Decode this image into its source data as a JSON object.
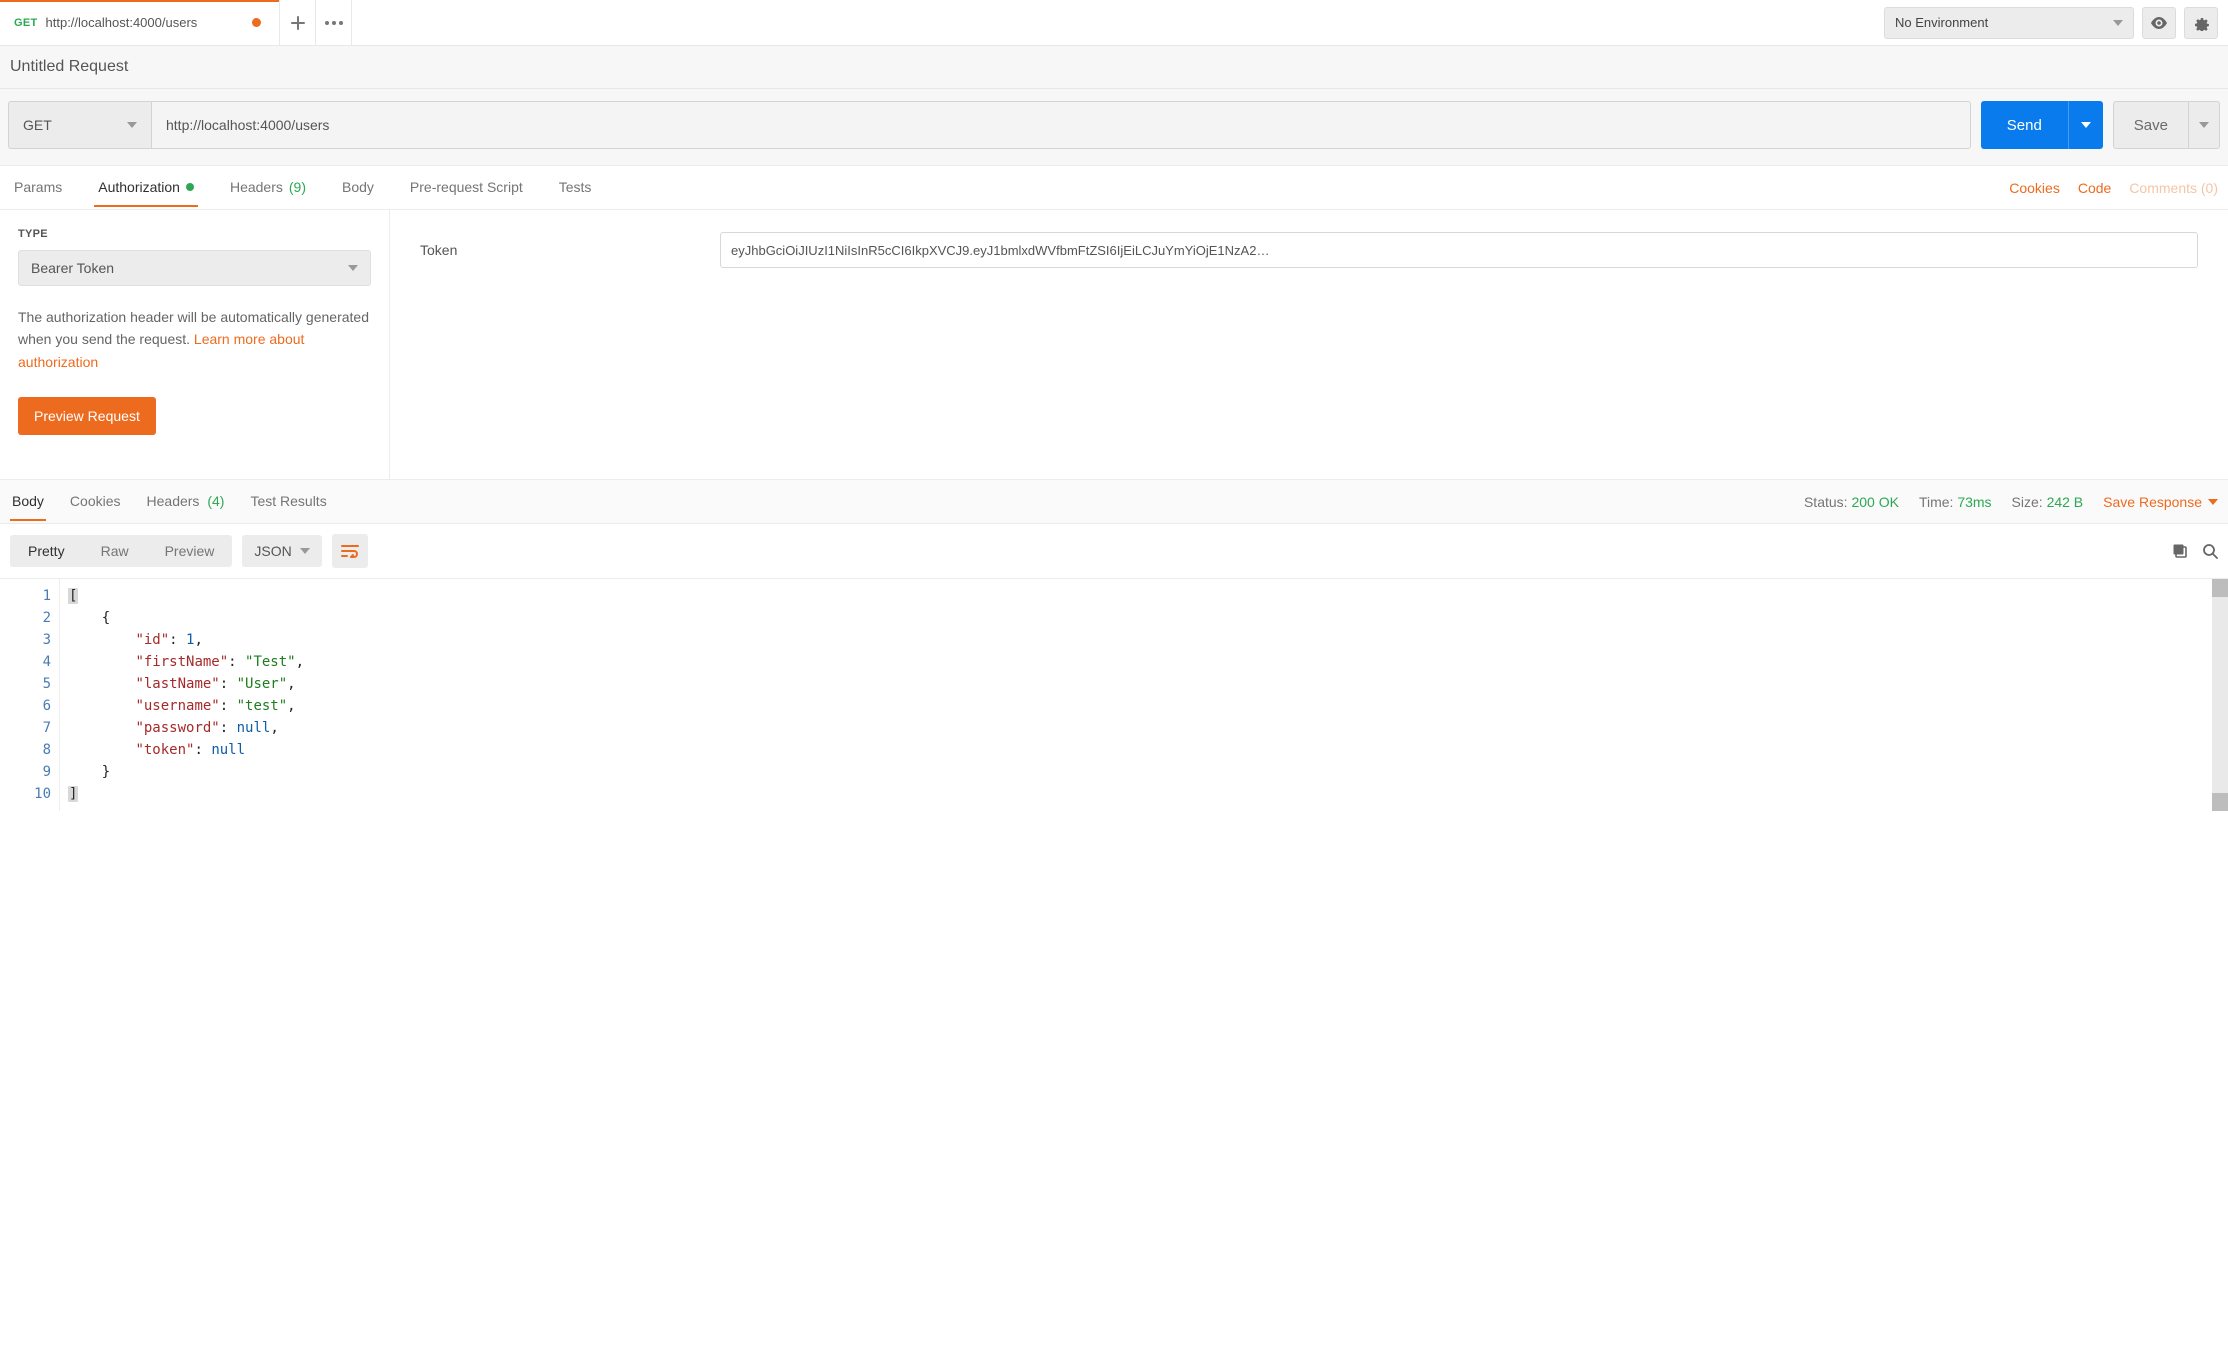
{
  "tab": {
    "method": "GET",
    "title": "http://localhost:4000/users"
  },
  "environment": {
    "selected": "No Environment"
  },
  "request": {
    "name": "Untitled Request",
    "method": "GET",
    "url": "http://localhost:4000/users",
    "send": "Send",
    "save": "Save"
  },
  "reqTabs": {
    "params": "Params",
    "authorization": "Authorization",
    "headers": "Headers",
    "headersCount": "(9)",
    "body": "Body",
    "prerequest": "Pre-request Script",
    "tests": "Tests",
    "cookies": "Cookies",
    "code": "Code",
    "comments": "Comments (0)"
  },
  "auth": {
    "typeLabel": "TYPE",
    "typeValue": "Bearer Token",
    "helperPrefix": "The authorization header will be automatically generated when you send the request. ",
    "helperLink": "Learn more about authorization",
    "previewBtn": "Preview Request",
    "tokenLabel": "Token",
    "tokenValue": "eyJhbGciOiJIUzI1NiIsInR5cCI6IkpXVCJ9.eyJ1bmlxdWVfbmFtZSI6IjEiLCJuYmYiOjE1NzA2…"
  },
  "respTabs": {
    "body": "Body",
    "cookies": "Cookies",
    "headers": "Headers",
    "headersCount": "(4)",
    "testResults": "Test Results"
  },
  "respMeta": {
    "statusLabel": "Status:",
    "statusValue": "200 OK",
    "timeLabel": "Time:",
    "timeValue": "73ms",
    "sizeLabel": "Size:",
    "sizeValue": "242 B",
    "saveResponse": "Save Response"
  },
  "bodyToolbar": {
    "pretty": "Pretty",
    "raw": "Raw",
    "preview": "Preview",
    "format": "JSON"
  },
  "lineNumbers": [
    "1",
    "2",
    "3",
    "4",
    "5",
    "6",
    "7",
    "8",
    "9",
    "10"
  ],
  "responseBody": [
    {
      "id": 1,
      "firstName": "Test",
      "lastName": "User",
      "username": "test",
      "password": null,
      "token": null
    }
  ]
}
